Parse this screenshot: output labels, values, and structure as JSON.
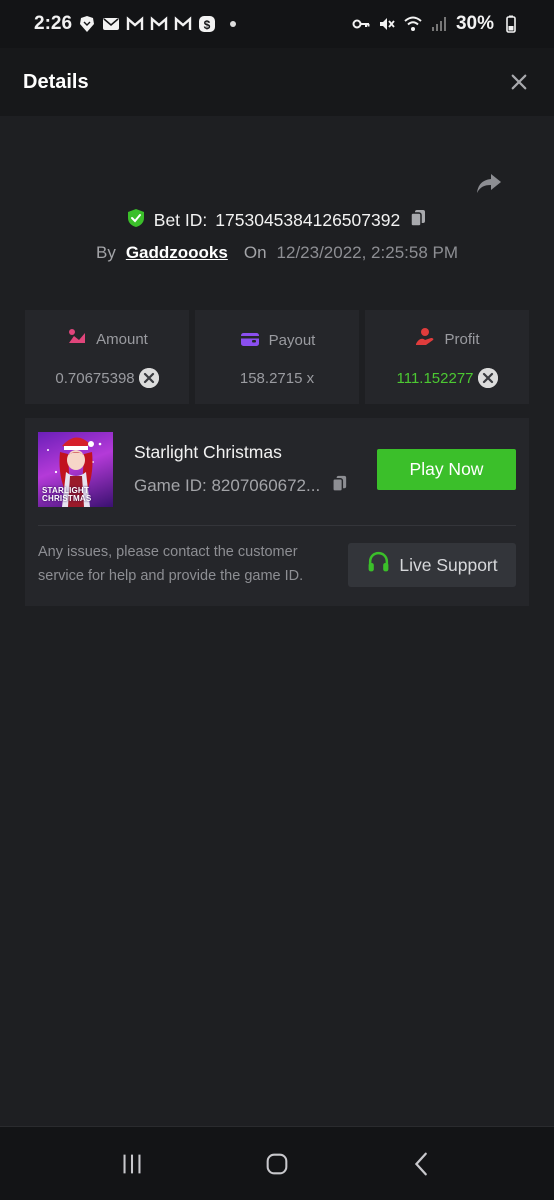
{
  "status_bar": {
    "time": "2:26",
    "battery": "30%",
    "left_icons": [
      "brave-icon",
      "mail-icon",
      "gmail-icon",
      "gmail-icon",
      "gmail-icon",
      "cash-app-icon"
    ],
    "right_icons": [
      "key-icon",
      "mute-icon",
      "wifi-icon",
      "signal-icon",
      "battery-icon"
    ]
  },
  "header": {
    "title": "Details"
  },
  "bet": {
    "label": "Bet ID:",
    "id": "1753045384126507392",
    "by_label": "By",
    "username": "Gaddzoooks",
    "on_label": "On",
    "date": "12/23/2022, 2:25:58 PM"
  },
  "stats": [
    {
      "label": "Amount",
      "value": "0.70675398",
      "icon": "amount-icon",
      "icon_color": "#e0457b"
    },
    {
      "label": "Payout",
      "value": "158.2715 x",
      "icon": "wallet-icon",
      "icon_color": "#8b4ff0"
    },
    {
      "label": "Profit",
      "value": "111.152277",
      "icon": "profit-icon",
      "icon_color": "#e03c3c"
    }
  ],
  "game": {
    "name": "Starlight Christmas",
    "game_id": "Game ID: 8207060672...",
    "thumb_text_line1": "STARLIGHT",
    "thumb_text_line2": "CHRISTMAS",
    "play_label": "Play Now",
    "help_text": "Any issues, please contact the customer service for help and provide the game ID.",
    "support_label": "Live Support"
  },
  "colors": {
    "accent_green": "#3bbf2a",
    "profit_green": "#4cc832",
    "background": "#1e1f22",
    "card": "#25262a"
  }
}
